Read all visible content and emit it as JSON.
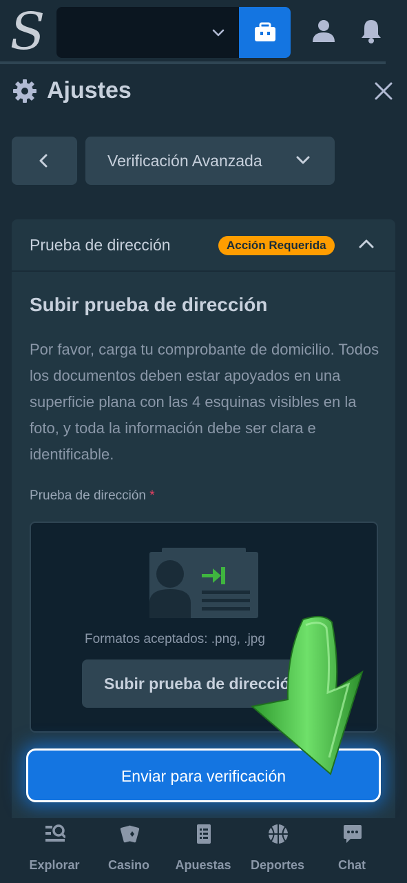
{
  "topbar": {
    "logo": "S",
    "icons": [
      "chevron-down-icon",
      "wallet-icon",
      "user-icon",
      "bell-icon"
    ]
  },
  "modal": {
    "title": "Ajustes",
    "section_select": "Verificación Avanzada",
    "card": {
      "header_label": "Prueba de dirección",
      "badge": "Acción Requerida",
      "title": "Subir prueba de dirección",
      "description": "Por favor, carga tu comprobante de domicilio. Todos los documentos deben estar apoyados en una superficie plana con las 4 esquinas visibles en la foto, y toda la información debe ser clara e identificable.",
      "field_label": "Prueba de dirección",
      "required_mark": "*",
      "formats": "Formatos aceptados: .png, .jpg",
      "upload_button": "Subir prueba de dirección"
    },
    "submit_button": "Enviar para verificación"
  },
  "bottom_nav": {
    "items": [
      {
        "label": "Explorar",
        "icon": "explore-icon"
      },
      {
        "label": "Casino",
        "icon": "cards-icon"
      },
      {
        "label": "Apuestas",
        "icon": "betslip-icon"
      },
      {
        "label": "Deportes",
        "icon": "basketball-icon"
      },
      {
        "label": "Chat",
        "icon": "chat-icon"
      }
    ]
  },
  "colors": {
    "background": "#0f212e",
    "panel": "#1a2c38",
    "card": "#213743",
    "accent_blue": "#1475e1",
    "badge_orange": "#ff9d00",
    "arrow_green": "#3fb53f"
  }
}
